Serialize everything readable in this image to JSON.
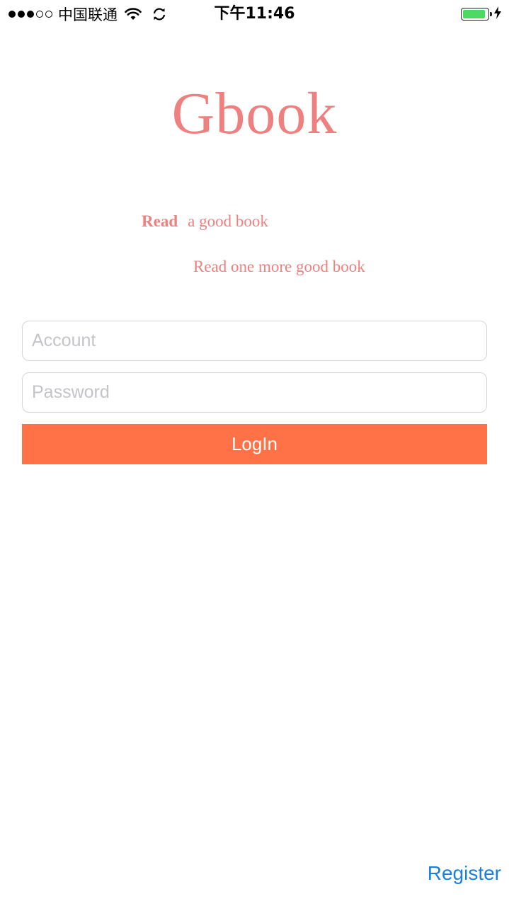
{
  "status_bar": {
    "carrier": "中国联通",
    "time": "下午11:46",
    "signal_bars_filled": 3,
    "signal_bars_total": 5,
    "wifi_icon": "wifi-icon",
    "sync_icon": "sync-icon",
    "battery_level_fraction": 0.9,
    "charging_icon": "bolt-icon",
    "battery_color": "#4cd964"
  },
  "brand": {
    "logo": "Gbook",
    "tagline_bold": "Read",
    "tagline_rest": "a good book",
    "tagline_second": "Read one more good book",
    "color": "#ef8080"
  },
  "form": {
    "account_placeholder": "Account",
    "account_value": "",
    "password_placeholder": "Password",
    "password_value": "",
    "login_label": "LogIn",
    "login_color": "#ff7147"
  },
  "footer": {
    "register_label": "Register",
    "link_color": "#1a7fe0"
  }
}
